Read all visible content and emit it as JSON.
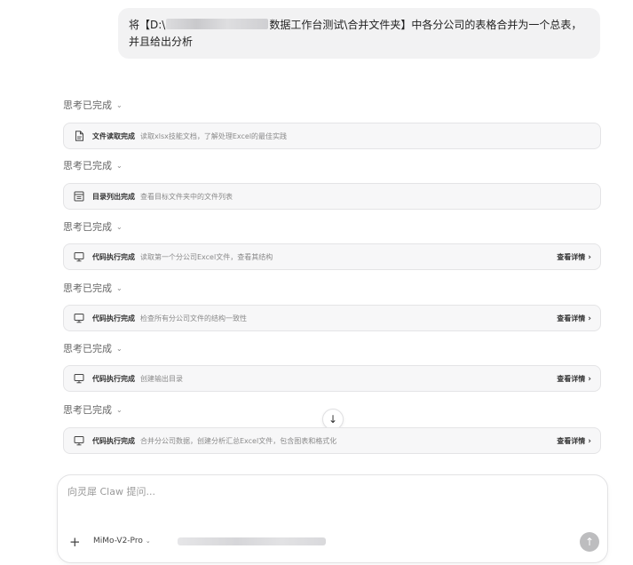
{
  "user_message": {
    "prefix": "将【D:\\",
    "suffix": "数据工作台测试\\合并文件夹】中各分公司的表格合并为一个总表，并且给出分析"
  },
  "thinking_label": "思考已完成",
  "steps": [
    {
      "icon": "document-icon",
      "status": "文件读取完成",
      "desc": "读取xlsx技能文档，了解处理Excel的最佳实践",
      "detail": ""
    },
    {
      "icon": "folder-list-icon",
      "status": "目录列出完成",
      "desc": "查看目标文件夹中的文件列表",
      "detail": ""
    },
    {
      "icon": "monitor-icon",
      "status": "代码执行完成",
      "desc": "读取第一个分公司Excel文件，查看其结构",
      "detail": "查看详情"
    },
    {
      "icon": "monitor-icon",
      "status": "代码执行完成",
      "desc": "检查所有分公司文件的结构一致性",
      "detail": "查看详情"
    },
    {
      "icon": "monitor-icon",
      "status": "代码执行完成",
      "desc": "创建输出目录",
      "detail": "查看详情"
    },
    {
      "icon": "monitor-icon",
      "status": "代码执行完成",
      "desc": "合并分公司数据，创建分析汇总Excel文件，包含图表和格式化",
      "detail": "查看详情"
    }
  ],
  "composer": {
    "placeholder": "向灵犀 Claw 提问...",
    "plus": "+",
    "model": "MiMo-V2-Pro"
  },
  "icons": {
    "chevron": "⌄",
    "arrow_right": "›",
    "arrow_down": "↓",
    "arrow_up": "↑"
  }
}
